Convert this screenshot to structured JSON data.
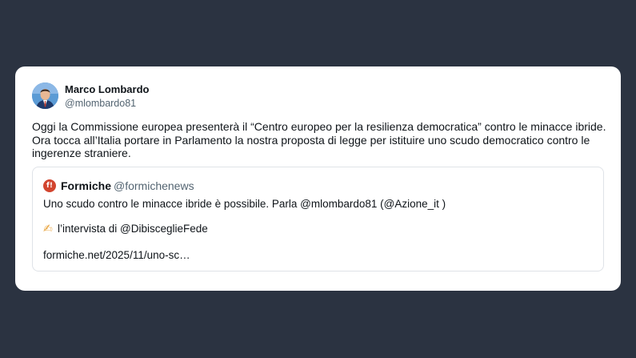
{
  "background_color": "#2b3341",
  "card_color": "#ffffff",
  "tweet": {
    "author": {
      "name": "Marco Lombardo",
      "handle": "@mlombardo81",
      "avatar_icon": "user-avatar"
    },
    "text_lines": [
      "Oggi la Commissione europea presenterà il “Centro europeo per la resilienza democratica” contro le minacce ibride.",
      "Ora tocca all’Italia portare in Parlamento la nostra proposta di legge per istituire uno scudo democratico contro le",
      "ingerenze straniere."
    ]
  },
  "quote": {
    "logo_icon": "formiche-logo-icon",
    "logo_color": "#d2452f",
    "name": "Formiche",
    "handle": "@formichenews",
    "line1": "Uno scudo contro le minacce ibride è possibile. Parla @mlombardo81  (@Azione_it )",
    "pen_icon": "writing-hand-icon",
    "line2": "l’intervista di @DibisceglieFede",
    "link": "formiche.net/2025/11/uno-sc…"
  }
}
